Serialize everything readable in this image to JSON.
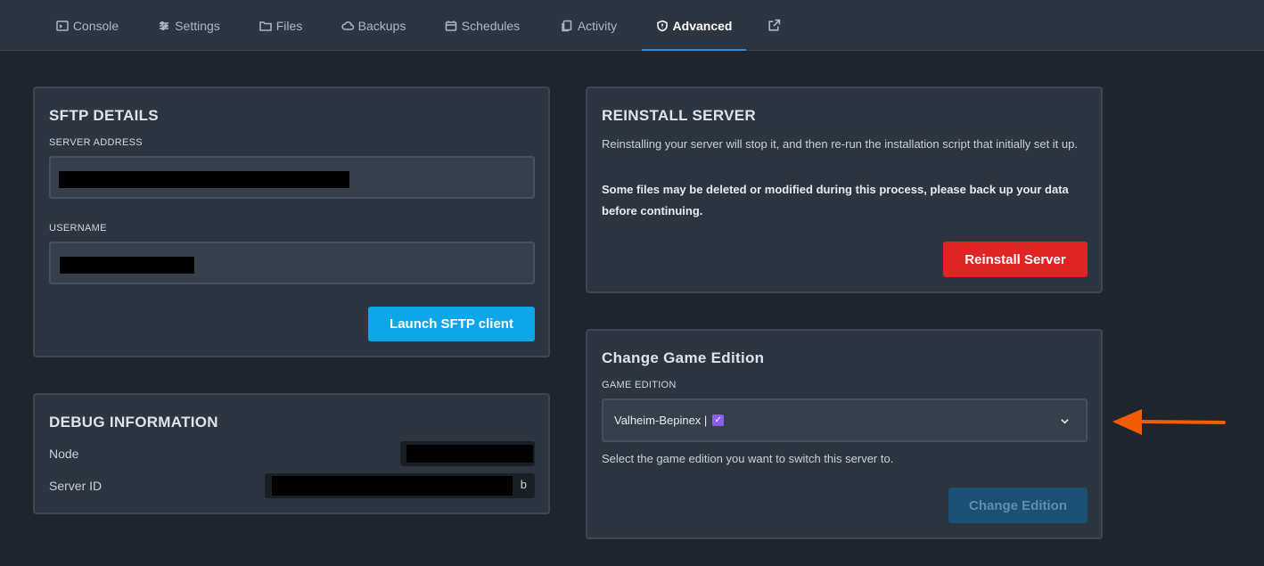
{
  "nav": {
    "tabs": [
      {
        "label": "Console",
        "icon": "terminal-icon"
      },
      {
        "label": "Settings",
        "icon": "sliders-icon"
      },
      {
        "label": "Files",
        "icon": "folder-icon"
      },
      {
        "label": "Backups",
        "icon": "cloud-icon"
      },
      {
        "label": "Schedules",
        "icon": "calendar-icon"
      },
      {
        "label": "Activity",
        "icon": "files-icon"
      },
      {
        "label": "Advanced",
        "icon": "shield-icon",
        "active": true
      }
    ],
    "external_icon": "external-link-icon"
  },
  "sftp": {
    "title": "SFTP DETAILS",
    "server_address_label": "SERVER ADDRESS",
    "username_label": "USERNAME",
    "launch_label": "Launch SFTP client"
  },
  "debug": {
    "title": "DEBUG INFORMATION",
    "node_label": "Node",
    "server_id_label": "Server ID",
    "server_id_suffix": "b"
  },
  "reinstall": {
    "title": "REINSTALL SERVER",
    "description": "Reinstalling your server will stop it, and then re-run the installation script that initially set it up.",
    "warning": "Some files may be deleted or modified during this process, please back up your data before continuing.",
    "button_label": "Reinstall Server"
  },
  "edition": {
    "title": "Change Game Edition",
    "label": "GAME EDITION",
    "selected": "Valheim-Bepinex |",
    "help": "Select the game edition you want to switch this server to.",
    "button_label": "Change Edition"
  },
  "colors": {
    "accent": "#2e8be0",
    "danger": "#e02424",
    "primary_button": "#0ea5e9",
    "annotation_arrow": "#f25c05"
  }
}
